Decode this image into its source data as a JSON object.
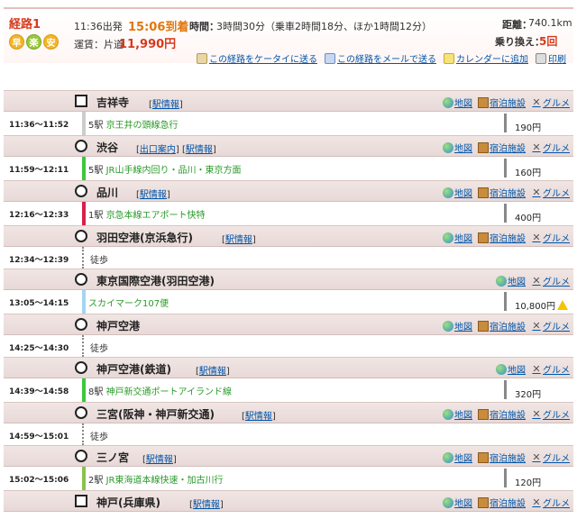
{
  "header": {
    "route_label": "経路1",
    "badges": [
      "早",
      "楽",
      "安"
    ],
    "depart": "11:36出発",
    "arrive": "15:06到着",
    "time_label": "時間：",
    "time_value": "3時間30分（乗車2時間18分、ほか1時間12分）",
    "fare_label": "運賃：片道",
    "fare_value": "11,990円",
    "distance_label": "距離：",
    "distance_value": "740.1km",
    "transfer_label": "乗り換え：",
    "transfer_value": "5回",
    "actions": {
      "mobile": "この経路をケータイに送る",
      "mail": "この経路をメールで送る",
      "calendar": "カレンダーに追加",
      "print": "印刷"
    }
  },
  "tools": {
    "map": "地図",
    "hotel": "宿泊施設",
    "gourmet": "グルメ"
  },
  "stations": [
    {
      "name": "吉祥寺",
      "links": [
        "駅情報"
      ],
      "hotel": true
    },
    {
      "name": "渋谷",
      "links": [
        "出口案内",
        "駅情報"
      ],
      "hotel": true
    },
    {
      "name": "品川",
      "links": [
        "駅情報"
      ],
      "hotel": true
    },
    {
      "name": "羽田空港(京浜急行)",
      "links": [
        "駅情報"
      ],
      "hotel": true
    },
    {
      "name": "東京国際空港(羽田空港)",
      "links": [],
      "hotel": false
    },
    {
      "name": "神戸空港",
      "links": [],
      "hotel": true
    },
    {
      "name": "神戸空港(鉄道)",
      "links": [
        "駅情報"
      ],
      "hotel": false
    },
    {
      "name": "三宮(阪神・神戸新交通)",
      "links": [
        "駅情報"
      ],
      "hotel": true
    },
    {
      "name": "三ノ宮",
      "links": [
        "駅情報"
      ],
      "hotel": true
    },
    {
      "name": "神戸(兵庫県)",
      "links": [
        "駅情報"
      ],
      "hotel": true
    }
  ],
  "legs": [
    {
      "time": "11:36～11:52",
      "stops": "5駅",
      "line": "京王井の頭線急行",
      "fare": "190円",
      "color": "#cccccc"
    },
    {
      "time": "11:59～12:11",
      "stops": "5駅",
      "line": "JR山手線内回り・品川・東京方面",
      "fare": "160円",
      "color": "#3cc83c"
    },
    {
      "time": "12:16～12:33",
      "stops": "1駅",
      "line": "京急本線エアポート快特",
      "fare": "400円",
      "color": "#d8204a"
    },
    {
      "time": "12:34～12:39",
      "walk": "徒歩"
    },
    {
      "time": "13:05～14:15",
      "stops": "",
      "line": "スカイマーク107便",
      "fare": "10,800円",
      "color": "#a6d4f2",
      "warning": true
    },
    {
      "time": "14:25～14:30",
      "walk": "徒歩"
    },
    {
      "time": "14:39～14:58",
      "stops": "8駅",
      "line": "神戸新交通ポートアイランド線",
      "fare": "320円",
      "color": "#3cc83c"
    },
    {
      "time": "14:59～15:01",
      "walk": "徒歩"
    },
    {
      "time": "15:02～15:06",
      "stops": "2駅",
      "line": "JR東海道本線快速・加古川行",
      "fare": "120円",
      "color": "#8ac24a"
    }
  ],
  "colors": {
    "accent": "#d63a1d",
    "arrive": "#e0780e",
    "link": "#0055aa",
    "station_bg": "#ebdedc"
  }
}
